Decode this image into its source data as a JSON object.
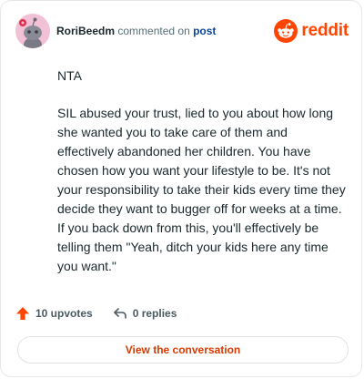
{
  "header": {
    "username": "RoriBeedm",
    "action_text": "commented on",
    "post_link": "post",
    "brand_name": "reddit"
  },
  "comment": {
    "paragraphs": [
      "NTA",
      "SIL abused your trust, lied to you about how long she wanted you to take care of them and effectively abandoned her children. You have chosen how you want your lifestyle to be. It's not your responsibility to take their kids every time they decide they want to bugger off for weeks at a time. If you back down from this, you'll effectively be telling them \"Yeah, ditch your kids here any time you want.\""
    ]
  },
  "footer": {
    "upvotes": "10 upvotes",
    "replies": "0 replies"
  },
  "cta": {
    "label": "View the conversation"
  },
  "colors": {
    "brand": "#ff4500",
    "cta_text": "#d93a00",
    "link": "#0a449b",
    "avatar_bg": "#f3c1d5"
  }
}
